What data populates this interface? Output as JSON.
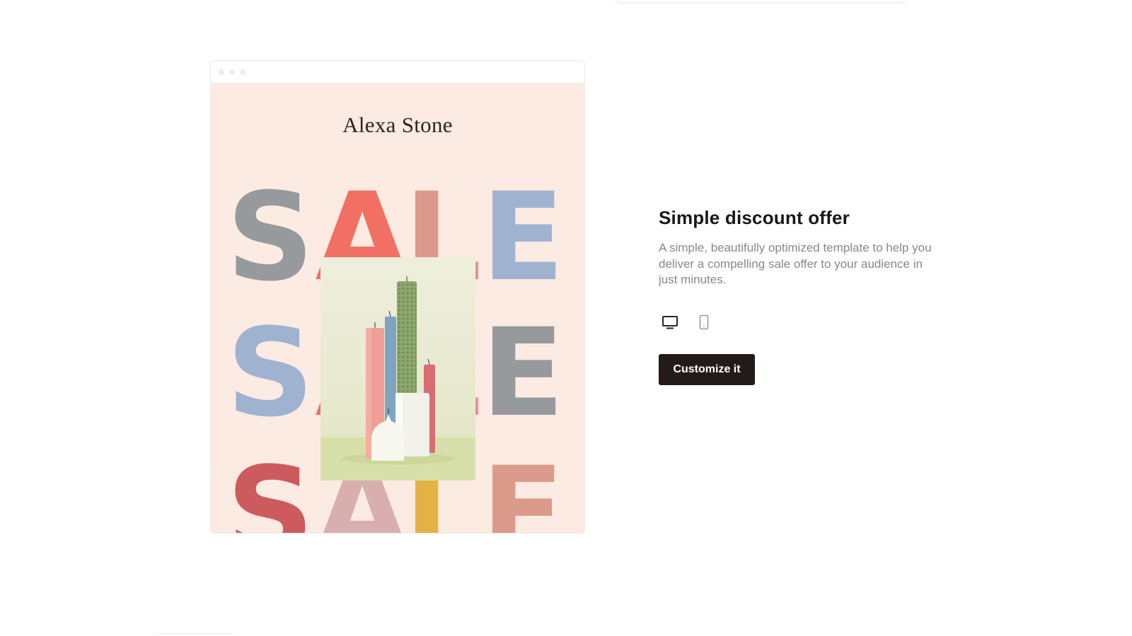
{
  "template": {
    "title": "Simple discount offer",
    "description": "A simple, beautifully optimized template to help you deliver a compelling sale offer to your audience in just minutes.",
    "cta_label": "Customize it",
    "view_options": [
      {
        "icon": "desktop-icon",
        "active": true
      },
      {
        "icon": "mobile-icon",
        "active": false
      }
    ]
  },
  "preview": {
    "brand_name": "Alexa Stone",
    "sale_word": "SALE",
    "background_color": "#fcebe2",
    "letter_colors": [
      [
        "#979a9c",
        "#f26f63",
        "#dc9a8a",
        "#9fb3d1"
      ],
      [
        "#9fb3d1",
        "#f26f63",
        "#ef8d98",
        "#979a9c"
      ],
      [
        "#cd5b5d",
        "#d9aeae",
        "#e4b144",
        "#dc9a8a"
      ]
    ]
  }
}
